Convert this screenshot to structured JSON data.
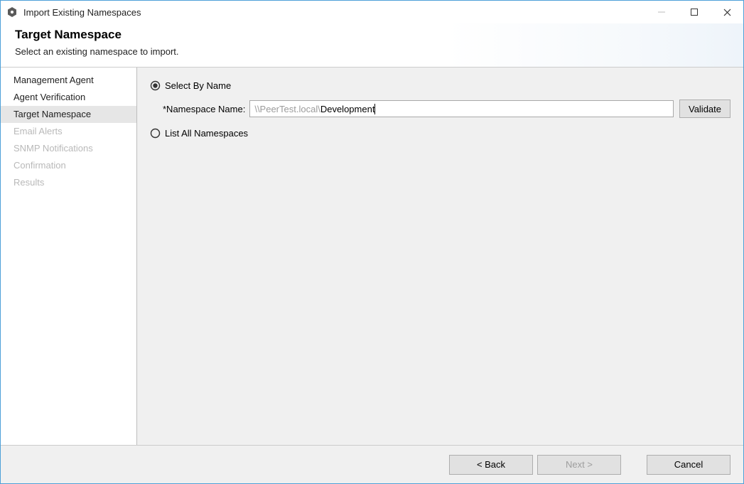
{
  "titlebar": {
    "title": "Import Existing Namespaces"
  },
  "header": {
    "title": "Target Namespace",
    "subtitle": "Select an existing namespace to import."
  },
  "sidebar": {
    "steps": [
      {
        "label": "Management Agent",
        "state": "done"
      },
      {
        "label": "Agent Verification",
        "state": "done"
      },
      {
        "label": "Target Namespace",
        "state": "current"
      },
      {
        "label": "Email Alerts",
        "state": "disabled"
      },
      {
        "label": "SNMP Notifications",
        "state": "disabled"
      },
      {
        "label": "Confirmation",
        "state": "disabled"
      },
      {
        "label": "Results",
        "state": "disabled"
      }
    ]
  },
  "main": {
    "select_by_name_label": "Select By Name",
    "namespace_name_label": "*Namespace Name:",
    "namespace_placeholder_prefix": "\\\\PeerTest.local\\ ",
    "namespace_value": "Development",
    "validate_label": "Validate",
    "list_all_label": "List All Namespaces",
    "selected_option": "by_name"
  },
  "footer": {
    "back_label": "< Back",
    "next_label": "Next >",
    "cancel_label": "Cancel"
  }
}
